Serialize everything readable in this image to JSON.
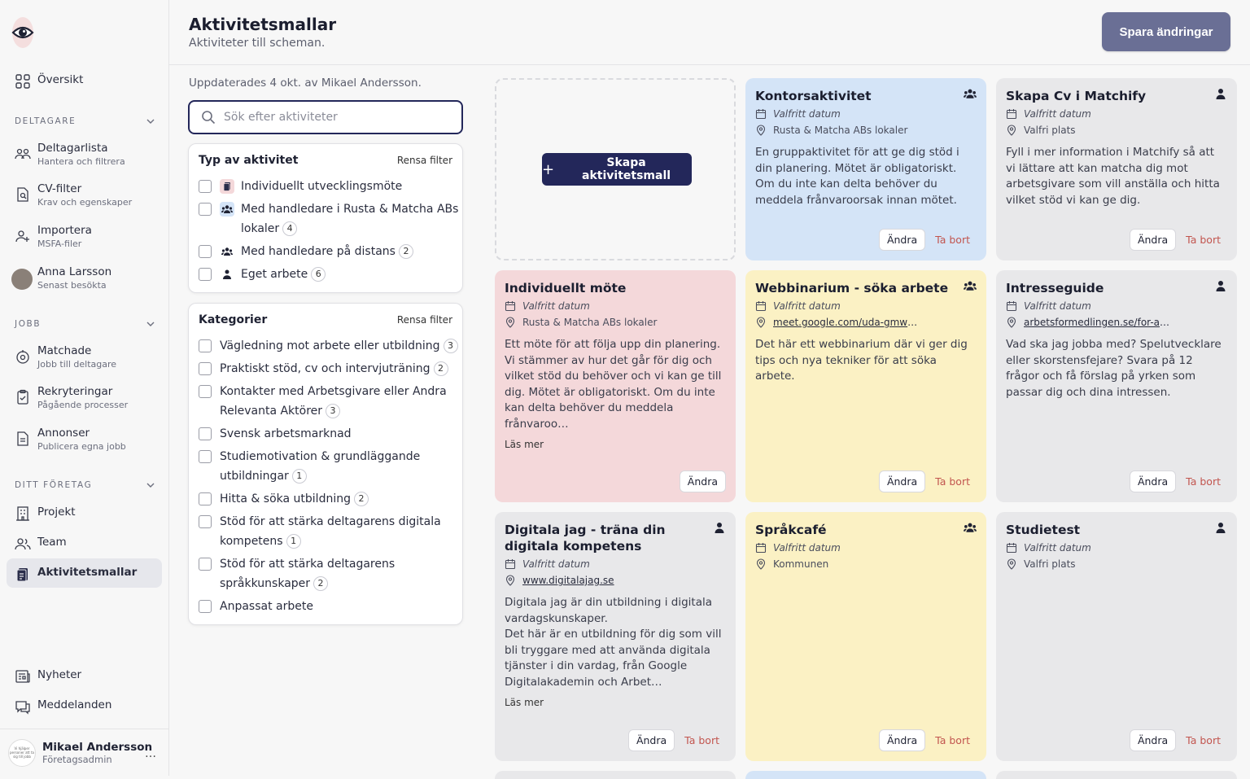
{
  "sidebar": {
    "overview": "Översikt",
    "sections": {
      "participants": "DELTAGARE",
      "jobs": "JOBB",
      "company": "DITT FÖRETAG"
    },
    "items": {
      "participant_list": {
        "label": "Deltagarlista",
        "sub": "Hantera och filtrera"
      },
      "cv_filter": {
        "label": "CV-filter",
        "sub": "Krav och egenskaper"
      },
      "import": {
        "label": "Importera",
        "sub": "MSFA-filer"
      },
      "recent": {
        "label": "Anna Larsson",
        "sub": "Senast besökta"
      },
      "matched": {
        "label": "Matchade",
        "sub": "Jobb till deltagare"
      },
      "recruitments": {
        "label": "Rekryteringar",
        "sub": "Pågående processer"
      },
      "ads": {
        "label": "Annonser",
        "sub": "Publicera egna jobb"
      },
      "projects": {
        "label": "Projekt"
      },
      "team": {
        "label": "Team"
      },
      "activity_templates": {
        "label": "Aktivitetsmallar"
      },
      "news": {
        "label": "Nyheter"
      },
      "messages": {
        "label": "Meddelanden"
      }
    },
    "user": {
      "name": "Mikael Andersson",
      "role": "Företagsadmin",
      "avatar_text": "Vi hjälper personer att ta sig till jobb",
      "more": "…"
    }
  },
  "header": {
    "title": "Aktivitetsmallar",
    "subtitle": "Aktiviteter till scheman.",
    "save_label": "Spara ändringar"
  },
  "updated_text": "Uppdaterades 4 okt. av Mikael Andersson.",
  "search": {
    "placeholder": "Sök efter aktiviteter"
  },
  "filters": {
    "type": {
      "title": "Typ av aktivitet",
      "clear": "Rensa filter",
      "options": [
        {
          "label": "Individuellt utvecklingsmöte",
          "count": ""
        },
        {
          "label": "Med handledare i Rusta & Matcha ABs",
          "label2": "lokaler",
          "count": "4"
        },
        {
          "label": "Med handledare på distans",
          "count": "2"
        },
        {
          "label": "Eget arbete",
          "count": "6"
        }
      ]
    },
    "categories": {
      "title": "Kategorier",
      "clear": "Rensa filter",
      "options": [
        {
          "label": "Vägledning mot arbete eller utbildning",
          "count": "3"
        },
        {
          "label": "Praktiskt stöd, cv och intervjuträning",
          "count": "2"
        },
        {
          "label": "Kontakter med Arbetsgivare eller Andra",
          "label2": "Relevanta Aktörer",
          "count": "3"
        },
        {
          "label": "Svensk arbetsmarknad",
          "count": ""
        },
        {
          "label": "Studiemotivation & grundläggande",
          "label2": "utbildningar",
          "count": "1"
        },
        {
          "label": "Hitta & söka utbildning",
          "count": "2"
        },
        {
          "label": "Stöd för att stärka deltagarens digitala",
          "label2": "kompetens",
          "count": "1"
        },
        {
          "label": "Stöd för att stärka deltagarens",
          "label2": "språkkunskaper",
          "count": "2"
        },
        {
          "label": "Anpassat arbete",
          "count": ""
        }
      ]
    }
  },
  "create_label": "Skapa aktivitetsmall",
  "cards": [
    {
      "title": "Kontorsaktivitet",
      "date": "Valfritt datum",
      "place": "Rusta & Matcha ABs lokaler",
      "desc": "En gruppaktivitet för att ge dig stöd i din planering. Mötet är obligatoriskt. Om du inte kan delta behöver du meddela frånvaroorsak innan mötet.",
      "edit": "Ändra",
      "delete": "Ta bort"
    },
    {
      "title": "Skapa Cv i Matchify",
      "date": "Valfritt datum",
      "place": "Valfri plats",
      "desc": "Fyll i mer information i Matchify så att vi lättare att kan matcha dig mot arbetsgivare som vill anställa och hitta vilket stöd vi kan ge dig.",
      "edit": "Ändra",
      "delete": "Ta bort"
    },
    {
      "title": "Individuellt möte",
      "date": "Valfritt datum",
      "place": "Rusta & Matcha ABs lokaler",
      "desc": "Ett möte för att följa upp din planering. Vi stämmer av hur det går för dig och vilket stöd du behöver och vi kan ge till dig. Mötet är obligatoriskt. Om du inte kan delta behöver du meddela frånvaroo…",
      "more": "Läs mer",
      "edit": "Ändra"
    },
    {
      "title": "Webbinarium - söka arbete",
      "date": "Valfritt datum",
      "link": "meet.google.com/uda-gmwb-s…",
      "desc": "Det här ett webbinarium där vi ger dig tips och nya tekniker för att söka arbete.",
      "edit": "Ändra",
      "delete": "Ta bort"
    },
    {
      "title": "Intresseguide",
      "date": "Valfritt datum",
      "link": "arbetsformedlingen.se/for-arbets…",
      "desc": "Vad ska jag jobba med? Spelutvecklare eller skorstensfejare? Svara på 12 frågor och få förslag på yrken som passar dig och dina intressen.",
      "edit": "Ändra",
      "delete": "Ta bort"
    },
    {
      "title": "Digitala jag - träna din digitala kompetens",
      "date": "Valfritt datum",
      "link": "www.digitalajag.se",
      "desc": "Digitala jag är din utbildning i digitala vardagskunskaper.\nDet här är en utbildning för dig som vill bli tryggare med att använda digitala tjänster i din vardag, från Google Digitalakademin och Arbet…",
      "more": "Läs mer",
      "edit": "Ändra",
      "delete": "Ta bort"
    },
    {
      "title": "Språkcafé",
      "date": "Valfritt datum",
      "place": "Kommunen",
      "edit": "Ändra",
      "delete": "Ta bort"
    },
    {
      "title": "Studietest",
      "date": "Valfritt datum",
      "place": "Valfri plats",
      "edit": "Ändra",
      "delete": "Ta bort"
    }
  ],
  "colors": {
    "blue": "#d4e4f7",
    "grey": "#e8e8ea",
    "pink": "#f4d8da",
    "yellow": "#fbf1c4",
    "navy": "#23275a"
  }
}
